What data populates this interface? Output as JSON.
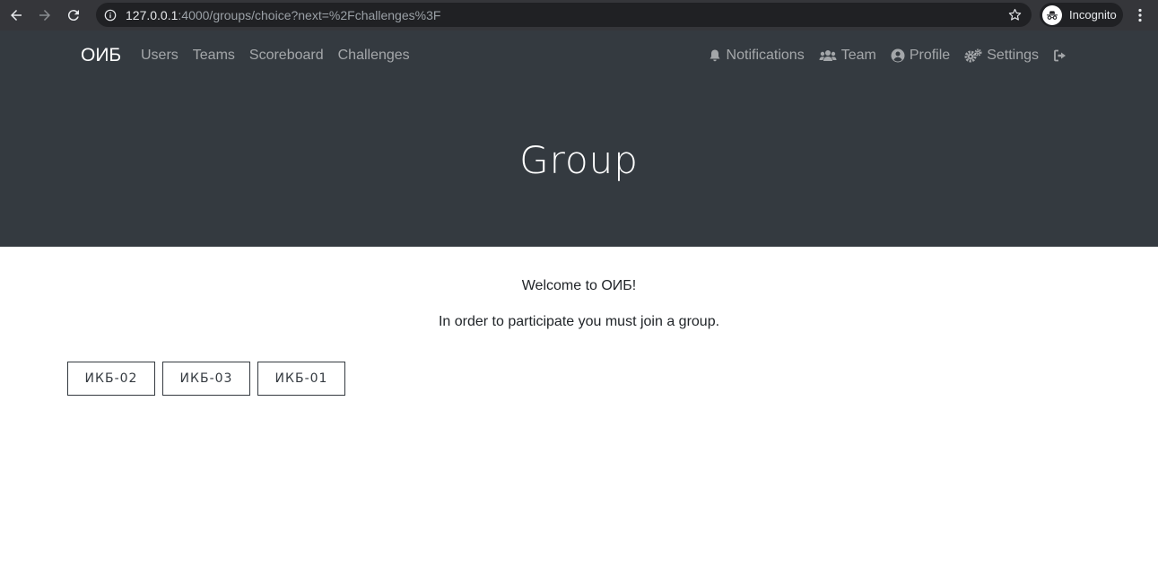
{
  "browser": {
    "url_host": "127.0.0.1",
    "url_rest": ":4000/groups/choice?next=%2Fchallenges%3F",
    "incognito_label": "Incognito"
  },
  "navbar": {
    "brand": "ОИБ",
    "left_links": [
      {
        "label": "Users"
      },
      {
        "label": "Teams"
      },
      {
        "label": "Scoreboard"
      },
      {
        "label": "Challenges"
      }
    ],
    "right_links": [
      {
        "label": "Notifications",
        "icon": "bell-icon"
      },
      {
        "label": "Team",
        "icon": "users-icon"
      },
      {
        "label": "Profile",
        "icon": "user-circle-icon"
      },
      {
        "label": "Settings",
        "icon": "gears-icon"
      }
    ],
    "logout_icon": "logout-icon"
  },
  "jumbotron": {
    "title": "Group"
  },
  "main": {
    "welcome": "Welcome to ОИБ!",
    "instruction": "In order to participate you must join a group.",
    "groups": [
      {
        "label": "ИКБ-02"
      },
      {
        "label": "ИКБ-03"
      },
      {
        "label": "ИКБ-01"
      }
    ]
  },
  "colors": {
    "navbar_bg": "#343a40",
    "chrome_bg": "#35363a",
    "omnibox_bg": "#202124"
  }
}
